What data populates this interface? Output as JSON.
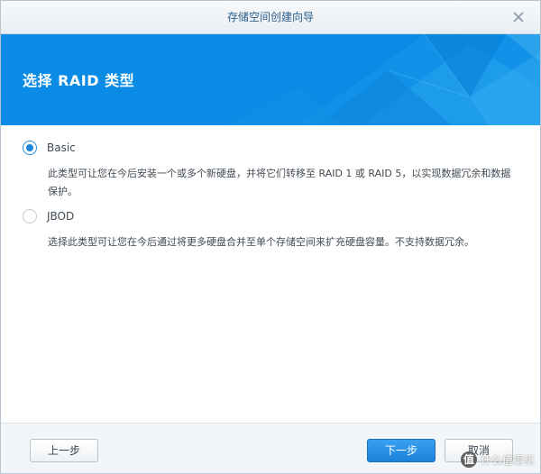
{
  "window": {
    "title": "存储空间创建向导"
  },
  "banner": {
    "title": "选择 RAID 类型"
  },
  "options": [
    {
      "label": "Basic",
      "selected": true,
      "description": "此类型可让您在今后安装一个或多个新硬盘，并将它们转移至 RAID 1 或 RAID 5，以实现数据冗余和数据保护。"
    },
    {
      "label": "JBOD",
      "selected": false,
      "description": "选择此类型可让您在今后通过将更多硬盘合并至单个存储空间来扩充硬盘容量。不支持数据冗余。"
    }
  ],
  "footer": {
    "back_label": "上一步",
    "next_label": "下一步",
    "cancel_label": "取消"
  },
  "watermark": {
    "badge": "值",
    "text": "什么值得买"
  },
  "colors": {
    "banner": "#0a8ce6",
    "accent": "#1f86e0",
    "title_text": "#2b5f8a"
  },
  "icons": {
    "close": "close-icon",
    "radio_checked": "radio-checked-icon",
    "radio_unchecked": "radio-unchecked-icon"
  }
}
